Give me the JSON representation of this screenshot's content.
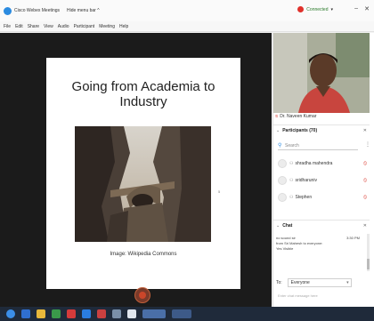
{
  "titlebar": {
    "title": "Cisco Webex Meetings",
    "hide_menu": "Hide menu bar ^",
    "connection": "Connected",
    "minimize": "–",
    "close": "✕"
  },
  "menu": [
    "File",
    "Edit",
    "Share",
    "View",
    "Audio",
    "Participant",
    "Meeting",
    "Help"
  ],
  "slide": {
    "title": "Going from Academia to Industry",
    "caption": "Image: Wikipedia Commons",
    "dot": "5"
  },
  "panel": {
    "video_name": "Dr. Naveen Kumar",
    "participants_header": "Participants (70)",
    "search_placeholder": "Search",
    "participants": [
      {
        "name": "shradha mahendra"
      },
      {
        "name": "sridharuniv"
      },
      {
        "name": "Stephen"
      }
    ],
    "chat_header": "Chat",
    "chat_lines": [
      "no sound sir",
      "from Sri Mahesh to everyone:",
      "Yes Visible"
    ],
    "chat_time": "3:30 PM",
    "to_label": "To:",
    "to_value": "Everyone",
    "message_placeholder": "Enter chat message here"
  },
  "colors": {
    "accent": "#2b8be0",
    "danger": "#d9362b",
    "stage_bg": "#1b1b1b",
    "taskbar_bg": "#1f2a3a"
  }
}
